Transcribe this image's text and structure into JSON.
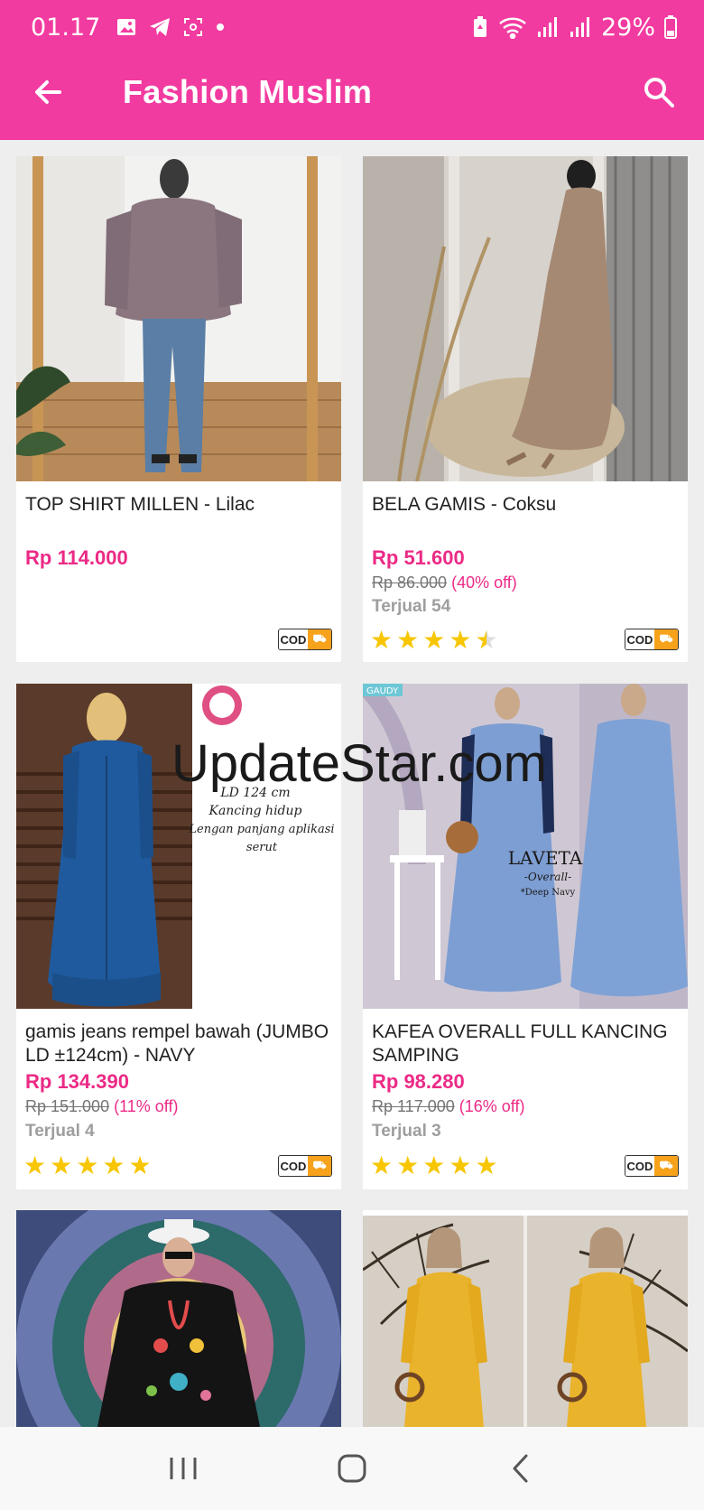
{
  "status_bar": {
    "time": "01.17",
    "battery": "29%",
    "icons": [
      "gallery-icon",
      "telegram-icon",
      "screenshot-icon",
      "dot-icon",
      "battery-saver-icon",
      "wifi-icon",
      "signal-icon",
      "signal-icon",
      "battery-icon"
    ]
  },
  "toolbar": {
    "title": "Fashion Muslim",
    "back_icon": "arrow-left-icon",
    "search_icon": "search-icon"
  },
  "colors": {
    "brand": "#f23ba0",
    "price": "#ec2a86",
    "star": "#f7c600",
    "cod_badge": "#f7a21b"
  },
  "products": [
    {
      "name": "TOP SHIRT MILLEN - Lilac",
      "price": "Rp 114.000",
      "cod_label": "COD"
    },
    {
      "name": "BELA GAMIS - Coksu",
      "price": "Rp 51.600",
      "original_price": "Rp 86.000",
      "discount": "(40% off)",
      "sold": "Terjual 54",
      "rating": 4.5,
      "cod_label": "COD"
    },
    {
      "name": "gamis jeans rempel bawah (JUMBO LD ±124cm) - NAVY",
      "price": "Rp 134.390",
      "original_price": "Rp 151.000",
      "discount": "(11% off)",
      "sold": "Terjual 4",
      "rating": 5,
      "cod_label": "COD",
      "image_text": [
        "LD 124 cm",
        "Kancing hidup",
        "Lengan panjang aplikasi",
        "serut"
      ]
    },
    {
      "name": "KAFEA OVERALL FULL KANCING SAMPING",
      "price": "Rp 98.280",
      "original_price": "Rp 117.000",
      "discount": "(16% off)",
      "sold": "Terjual 3",
      "rating": 5,
      "cod_label": "COD",
      "image_text": [
        "GAUDY",
        "LAVETA",
        "-Overall-",
        "*Deep Navy"
      ]
    },
    {},
    {}
  ],
  "watermark": "UpdateStar.com",
  "nav": {
    "recents_icon": "recents-icon",
    "home_icon": "home-icon",
    "back_icon": "back-icon"
  }
}
